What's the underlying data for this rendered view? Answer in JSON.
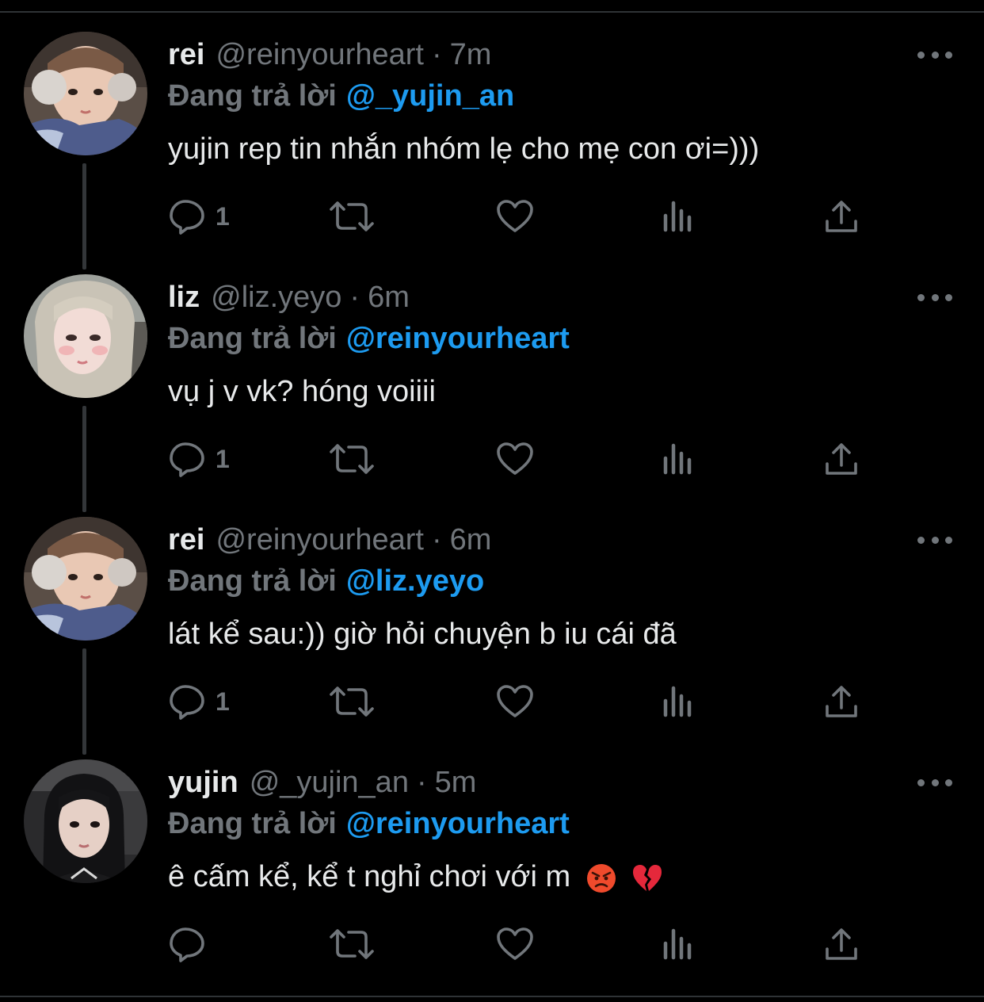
{
  "tweets": [
    {
      "name": "rei",
      "handle": "@reinyourheart",
      "time": "7m",
      "replying_label": "Đang trả lời",
      "mention": "@_yujin_an",
      "text": "yujin rep tin nhắn nhóm lẹ cho mẹ con ơi=)))",
      "reply_count": "1",
      "avatar": "rei-avatar"
    },
    {
      "name": "liz",
      "handle": "@liz.yeyo",
      "time": "6m",
      "replying_label": "Đang trả lời",
      "mention": "@reinyourheart",
      "text": "vụ j v vk? hóng voiiii",
      "reply_count": "1",
      "avatar": "liz-avatar"
    },
    {
      "name": "rei",
      "handle": "@reinyourheart",
      "time": "6m",
      "replying_label": "Đang trả lời",
      "mention": "@liz.yeyo",
      "text": "lát kể sau:)) giờ hỏi chuyện b iu cái đã",
      "reply_count": "1",
      "avatar": "rei-avatar"
    },
    {
      "name": "yujin",
      "handle": "@_yujin_an",
      "time": "5m",
      "replying_label": "Đang trả lời",
      "mention": "@reinyourheart",
      "text": "ê cấm kể, kể t nghỉ chơi với m",
      "reply_count": "",
      "avatar": "yujin-avatar",
      "emojis": [
        "angry-face-emoji",
        "broken-heart-emoji"
      ]
    }
  ],
  "separator": "·",
  "colors": {
    "background": "#000000",
    "text_primary": "#e7e9ea",
    "text_secondary": "#71767b",
    "accent": "#1d9bf0",
    "thread_line": "#333639"
  },
  "icons": [
    "reply-icon",
    "retweet-icon",
    "like-icon",
    "views-icon",
    "share-icon",
    "more-icon"
  ]
}
